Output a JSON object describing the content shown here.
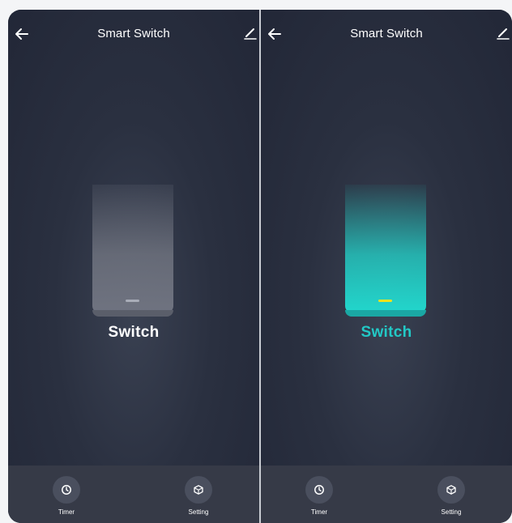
{
  "screens": [
    {
      "state": "off",
      "header": {
        "title": "Smart Switch",
        "back_icon": "arrow-left-icon",
        "edit_icon": "pencil-icon"
      },
      "switch": {
        "label": "Switch",
        "on": false
      },
      "bottom_bar": {
        "timer_label": "Timer",
        "setting_label": "Setting"
      }
    },
    {
      "state": "on",
      "header": {
        "title": "Smart Switch",
        "back_icon": "arrow-left-icon",
        "edit_icon": "pencil-icon"
      },
      "switch": {
        "label": "Switch",
        "on": true
      },
      "bottom_bar": {
        "timer_label": "Timer",
        "setting_label": "Setting"
      }
    }
  ],
  "colors": {
    "background": "#2a3040",
    "on_accent": "#22d6cc",
    "on_label": "#22c9c6",
    "indicator_on": "#f2e21b",
    "bottom_bar": "#363a47"
  }
}
